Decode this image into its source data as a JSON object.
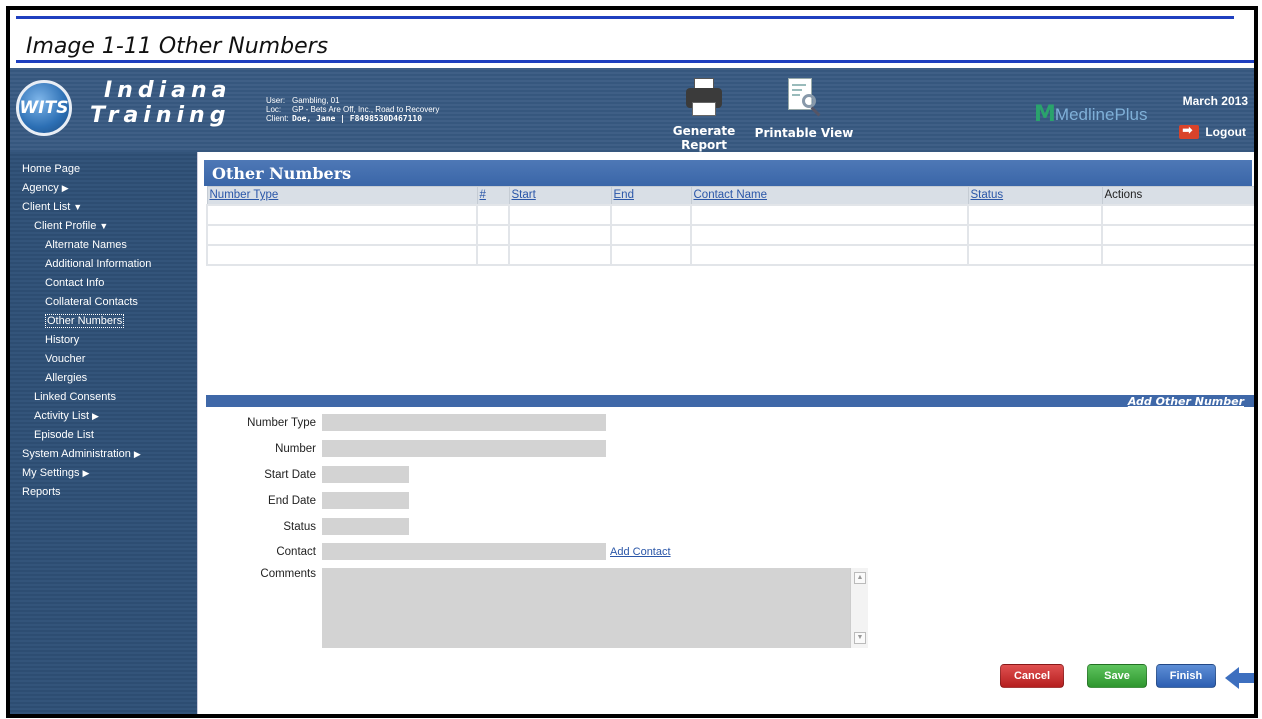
{
  "caption": "Image 1-11 Other Numbers",
  "header": {
    "logo": "WITS",
    "brand_line1": "Indiana",
    "brand_line2": "Training",
    "user_label": "User:",
    "user_value": "Gambling, 01",
    "loc_label": "Loc:",
    "loc_value": "GP - Bets Are Off, Inc., Road to Recovery",
    "client_label": "Client:",
    "client_value": "Doe, Jane | F8498530D467110",
    "generate_report": "Generate Report",
    "printable_view": "Printable View",
    "medline": "MedlinePlus",
    "date": "March 2013",
    "logout": "Logout"
  },
  "sidebar": {
    "items": [
      {
        "label": "Home Page",
        "level": 0
      },
      {
        "label": "Agency",
        "level": 0,
        "arrow": "▶"
      },
      {
        "label": "Client List",
        "level": 0,
        "arrow": "▼"
      },
      {
        "label": "Client Profile",
        "level": 1,
        "arrow": "▼"
      },
      {
        "label": "Alternate Names",
        "level": 2
      },
      {
        "label": "Additional Information",
        "level": 2
      },
      {
        "label": "Contact Info",
        "level": 2
      },
      {
        "label": "Collateral Contacts",
        "level": 2
      },
      {
        "label": "Other Numbers",
        "level": 2,
        "active": true
      },
      {
        "label": "History",
        "level": 2
      },
      {
        "label": "Voucher",
        "level": 2
      },
      {
        "label": "Allergies",
        "level": 2
      },
      {
        "label": "Linked Consents",
        "level": 1
      },
      {
        "label": "Activity List",
        "level": 1,
        "arrow": "▶"
      },
      {
        "label": "Episode List",
        "level": 1
      },
      {
        "label": "System Administration",
        "level": 0,
        "arrow": "▶"
      },
      {
        "label": "My Settings",
        "level": 0,
        "arrow": "▶"
      },
      {
        "label": "Reports",
        "level": 0
      }
    ]
  },
  "main": {
    "title": "Other Numbers",
    "columns": [
      "Number Type",
      "#",
      "Start",
      "End",
      "Contact Name",
      "Status",
      "Actions"
    ],
    "add_other_number": "Add Other Number",
    "form": {
      "number_type_label": "Number Type",
      "number_label": "Number",
      "start_date_label": "Start Date",
      "end_date_label": "End Date",
      "status_label": "Status",
      "contact_label": "Contact",
      "add_contact": "Add Contact",
      "comments_label": "Comments"
    },
    "buttons": {
      "cancel": "Cancel",
      "save": "Save",
      "finish": "Finish"
    }
  }
}
